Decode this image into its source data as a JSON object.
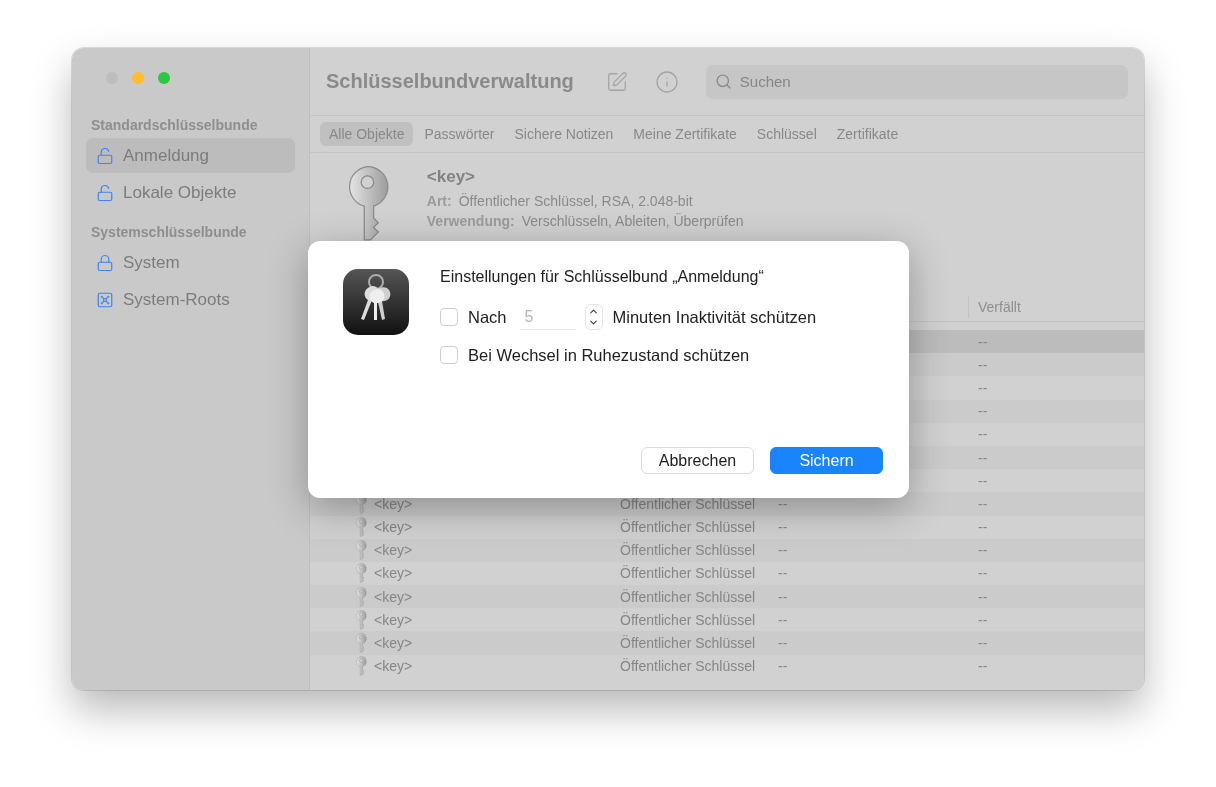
{
  "window": {
    "title": "Schlüsselbundverwaltung"
  },
  "sidebar": {
    "sections": [
      {
        "heading": "Standardschlüsselbunde",
        "items": [
          {
            "label": "Anmeldung",
            "kind": "unlocked",
            "selected": true
          },
          {
            "label": "Lokale Objekte",
            "kind": "unlocked",
            "selected": false
          }
        ]
      },
      {
        "heading": "Systemschlüsselbunde",
        "items": [
          {
            "label": "System",
            "kind": "locked",
            "selected": false
          },
          {
            "label": "System-Roots",
            "kind": "vault",
            "selected": false
          }
        ]
      }
    ]
  },
  "search": {
    "placeholder": "Suchen"
  },
  "tabs": [
    {
      "label": "Alle Objekte",
      "selected": true
    },
    {
      "label": "Passwörter",
      "selected": false
    },
    {
      "label": "Sichere Notizen",
      "selected": false
    },
    {
      "label": "Meine Zertifikate",
      "selected": false
    },
    {
      "label": "Schlüssel",
      "selected": false
    },
    {
      "label": "Zertifikate",
      "selected": false
    }
  ],
  "detail": {
    "name": "<key>",
    "fields": [
      {
        "label": "Art:",
        "value": "Öffentlicher Schlüssel, RSA, 2.048-bit"
      },
      {
        "label": "Verwendung:",
        "value": "Verschlüsseln, Ableiten, Überprüfen"
      }
    ]
  },
  "table": {
    "columns": [
      "Verfällt"
    ],
    "rows": [
      {
        "expires": "--",
        "selected": true
      },
      {
        "expires": "--",
        "selected": false
      },
      {
        "expires": "--",
        "selected": false
      },
      {
        "expires": "--",
        "selected": false
      },
      {
        "expires": "--",
        "selected": false
      },
      {
        "expires": "--",
        "selected": false
      },
      {
        "expires": "--",
        "selected": false
      },
      {
        "name": "<key>",
        "kind": "Öffentlicher Schlüssel",
        "date": "--",
        "expires": "--",
        "selected": false
      },
      {
        "name": "<key>",
        "kind": "Öffentlicher Schlüssel",
        "date": "--",
        "expires": "--",
        "selected": false
      },
      {
        "name": "<key>",
        "kind": "Öffentlicher Schlüssel",
        "date": "--",
        "expires": "--",
        "selected": false
      },
      {
        "name": "<key>",
        "kind": "Öffentlicher Schlüssel",
        "date": "--",
        "expires": "--",
        "selected": false
      },
      {
        "name": "<key>",
        "kind": "Öffentlicher Schlüssel",
        "date": "--",
        "expires": "--",
        "selected": false
      },
      {
        "name": "<key>",
        "kind": "Öffentlicher Schlüssel",
        "date": "--",
        "expires": "--",
        "selected": false
      },
      {
        "name": "<key>",
        "kind": "Öffentlicher Schlüssel",
        "date": "--",
        "expires": "--",
        "selected": false
      },
      {
        "name": "<key>",
        "kind": "Öffentlicher Schlüssel",
        "date": "--",
        "expires": "--",
        "selected": false
      }
    ]
  },
  "dialog": {
    "title": "Einstellungen für Schlüsselbund „Anmeldung“",
    "options": [
      {
        "kind": "stepper",
        "checked": false,
        "label": "Nach",
        "value": "5",
        "disabled": true,
        "suffix": "Minuten Inaktivität schützen"
      },
      {
        "kind": "checkbox",
        "checked": false,
        "label": "Bei Wechsel in Ruhezustand schützen"
      }
    ],
    "buttons": [
      {
        "label": "Abbrechen",
        "kind": "secondary"
      },
      {
        "label": "Sichern",
        "kind": "primary"
      }
    ]
  }
}
